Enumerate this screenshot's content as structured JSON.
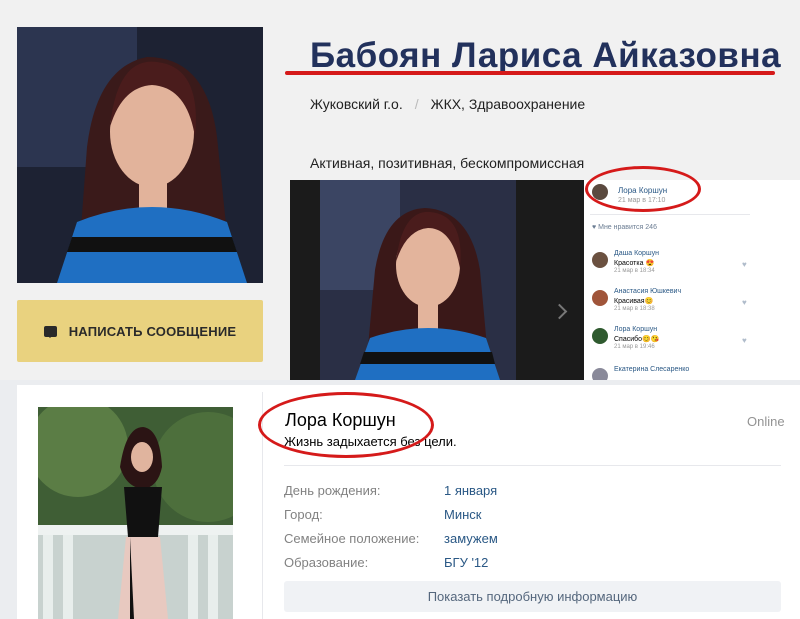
{
  "profile": {
    "name": "Бабоян Лариса Айказовна",
    "district": "Жуковский г.о.",
    "sector": "ЖКХ, Здравоохранение",
    "motto": "Активная, позитивная, бескомпромиссная",
    "message_button": "НАПИСАТЬ СООБЩЕНИЕ",
    "accent_color": "#e9d27f",
    "title_color": "#22315c"
  },
  "post_screenshot": {
    "author": "Лора Коршун",
    "time": "21 мар в 17:10",
    "likes": "Мне нравится 246",
    "comments": [
      {
        "name": "Даша Коршун",
        "text": "Красотка 😍",
        "date": "21 мар в 18:34"
      },
      {
        "name": "Анастасия Юшкевич",
        "text": "Красивая😊",
        "date": "21 мар в 18:38"
      },
      {
        "name": "Лора Коршун",
        "text": "Спасибо😊😘",
        "date": "21 мар в 19:46"
      },
      {
        "name": "Екатерина Слесаренко",
        "text": "",
        "date": ""
      }
    ]
  },
  "vk_profile": {
    "name": "Лора Коршун",
    "status": "Жизнь задыхается без цели.",
    "online": "Online",
    "fields": [
      {
        "label": "День рождения:",
        "value": "1 января"
      },
      {
        "label": "Город:",
        "value": "Минск"
      },
      {
        "label": "Семейное положение:",
        "value": "замужем"
      },
      {
        "label": "Образование:",
        "value": "БГУ '12"
      }
    ],
    "more_button": "Показать подробную информацию"
  },
  "highlight_color": "#d51a1a"
}
